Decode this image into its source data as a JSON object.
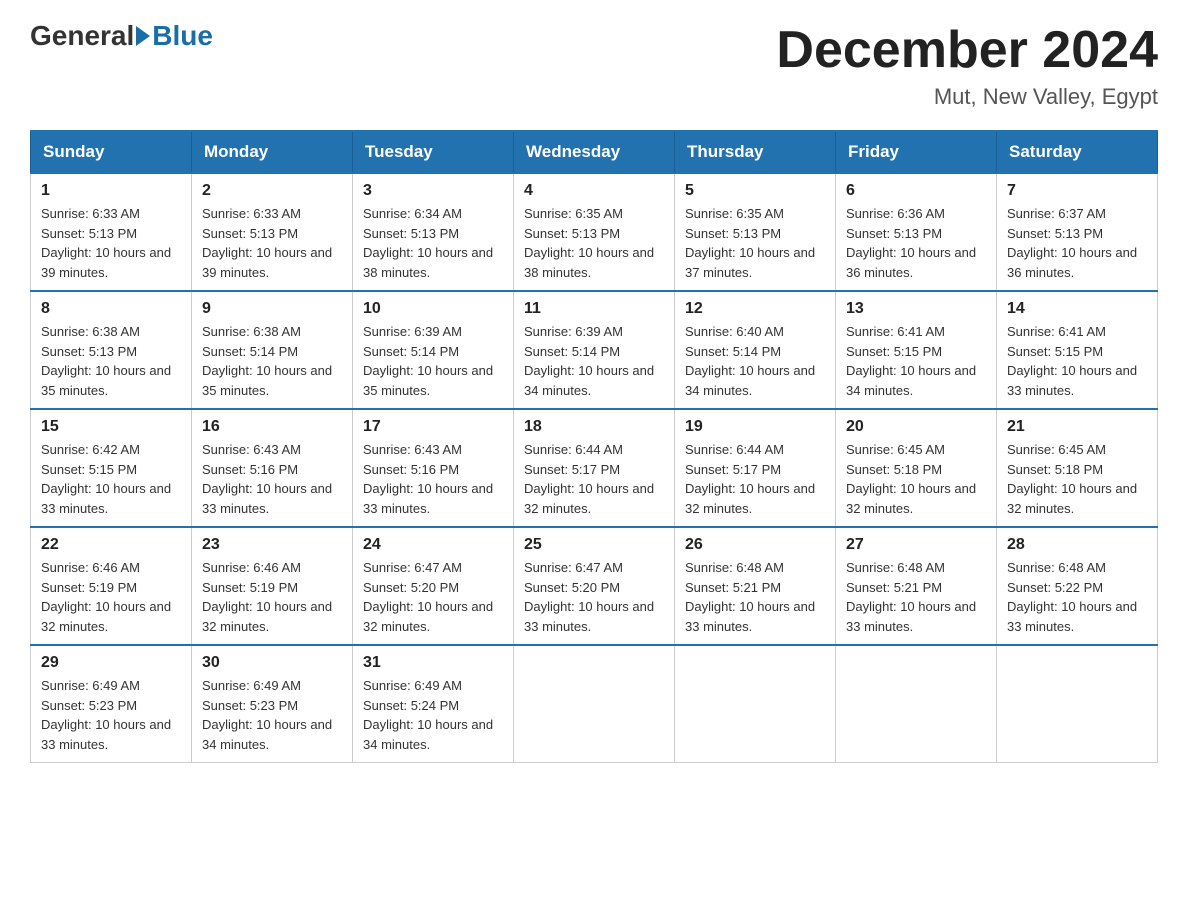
{
  "header": {
    "logo_general": "General",
    "logo_blue": "Blue",
    "month_title": "December 2024",
    "location": "Mut, New Valley, Egypt"
  },
  "weekdays": [
    "Sunday",
    "Monday",
    "Tuesday",
    "Wednesday",
    "Thursday",
    "Friday",
    "Saturday"
  ],
  "weeks": [
    [
      {
        "day": "1",
        "sunrise": "6:33 AM",
        "sunset": "5:13 PM",
        "daylight": "10 hours and 39 minutes."
      },
      {
        "day": "2",
        "sunrise": "6:33 AM",
        "sunset": "5:13 PM",
        "daylight": "10 hours and 39 minutes."
      },
      {
        "day": "3",
        "sunrise": "6:34 AM",
        "sunset": "5:13 PM",
        "daylight": "10 hours and 38 minutes."
      },
      {
        "day": "4",
        "sunrise": "6:35 AM",
        "sunset": "5:13 PM",
        "daylight": "10 hours and 38 minutes."
      },
      {
        "day": "5",
        "sunrise": "6:35 AM",
        "sunset": "5:13 PM",
        "daylight": "10 hours and 37 minutes."
      },
      {
        "day": "6",
        "sunrise": "6:36 AM",
        "sunset": "5:13 PM",
        "daylight": "10 hours and 36 minutes."
      },
      {
        "day": "7",
        "sunrise": "6:37 AM",
        "sunset": "5:13 PM",
        "daylight": "10 hours and 36 minutes."
      }
    ],
    [
      {
        "day": "8",
        "sunrise": "6:38 AM",
        "sunset": "5:13 PM",
        "daylight": "10 hours and 35 minutes."
      },
      {
        "day": "9",
        "sunrise": "6:38 AM",
        "sunset": "5:14 PM",
        "daylight": "10 hours and 35 minutes."
      },
      {
        "day": "10",
        "sunrise": "6:39 AM",
        "sunset": "5:14 PM",
        "daylight": "10 hours and 35 minutes."
      },
      {
        "day": "11",
        "sunrise": "6:39 AM",
        "sunset": "5:14 PM",
        "daylight": "10 hours and 34 minutes."
      },
      {
        "day": "12",
        "sunrise": "6:40 AM",
        "sunset": "5:14 PM",
        "daylight": "10 hours and 34 minutes."
      },
      {
        "day": "13",
        "sunrise": "6:41 AM",
        "sunset": "5:15 PM",
        "daylight": "10 hours and 34 minutes."
      },
      {
        "day": "14",
        "sunrise": "6:41 AM",
        "sunset": "5:15 PM",
        "daylight": "10 hours and 33 minutes."
      }
    ],
    [
      {
        "day": "15",
        "sunrise": "6:42 AM",
        "sunset": "5:15 PM",
        "daylight": "10 hours and 33 minutes."
      },
      {
        "day": "16",
        "sunrise": "6:43 AM",
        "sunset": "5:16 PM",
        "daylight": "10 hours and 33 minutes."
      },
      {
        "day": "17",
        "sunrise": "6:43 AM",
        "sunset": "5:16 PM",
        "daylight": "10 hours and 33 minutes."
      },
      {
        "day": "18",
        "sunrise": "6:44 AM",
        "sunset": "5:17 PM",
        "daylight": "10 hours and 32 minutes."
      },
      {
        "day": "19",
        "sunrise": "6:44 AM",
        "sunset": "5:17 PM",
        "daylight": "10 hours and 32 minutes."
      },
      {
        "day": "20",
        "sunrise": "6:45 AM",
        "sunset": "5:18 PM",
        "daylight": "10 hours and 32 minutes."
      },
      {
        "day": "21",
        "sunrise": "6:45 AM",
        "sunset": "5:18 PM",
        "daylight": "10 hours and 32 minutes."
      }
    ],
    [
      {
        "day": "22",
        "sunrise": "6:46 AM",
        "sunset": "5:19 PM",
        "daylight": "10 hours and 32 minutes."
      },
      {
        "day": "23",
        "sunrise": "6:46 AM",
        "sunset": "5:19 PM",
        "daylight": "10 hours and 32 minutes."
      },
      {
        "day": "24",
        "sunrise": "6:47 AM",
        "sunset": "5:20 PM",
        "daylight": "10 hours and 32 minutes."
      },
      {
        "day": "25",
        "sunrise": "6:47 AM",
        "sunset": "5:20 PM",
        "daylight": "10 hours and 33 minutes."
      },
      {
        "day": "26",
        "sunrise": "6:48 AM",
        "sunset": "5:21 PM",
        "daylight": "10 hours and 33 minutes."
      },
      {
        "day": "27",
        "sunrise": "6:48 AM",
        "sunset": "5:21 PM",
        "daylight": "10 hours and 33 minutes."
      },
      {
        "day": "28",
        "sunrise": "6:48 AM",
        "sunset": "5:22 PM",
        "daylight": "10 hours and 33 minutes."
      }
    ],
    [
      {
        "day": "29",
        "sunrise": "6:49 AM",
        "sunset": "5:23 PM",
        "daylight": "10 hours and 33 minutes."
      },
      {
        "day": "30",
        "sunrise": "6:49 AM",
        "sunset": "5:23 PM",
        "daylight": "10 hours and 34 minutes."
      },
      {
        "day": "31",
        "sunrise": "6:49 AM",
        "sunset": "5:24 PM",
        "daylight": "10 hours and 34 minutes."
      },
      null,
      null,
      null,
      null
    ]
  ]
}
